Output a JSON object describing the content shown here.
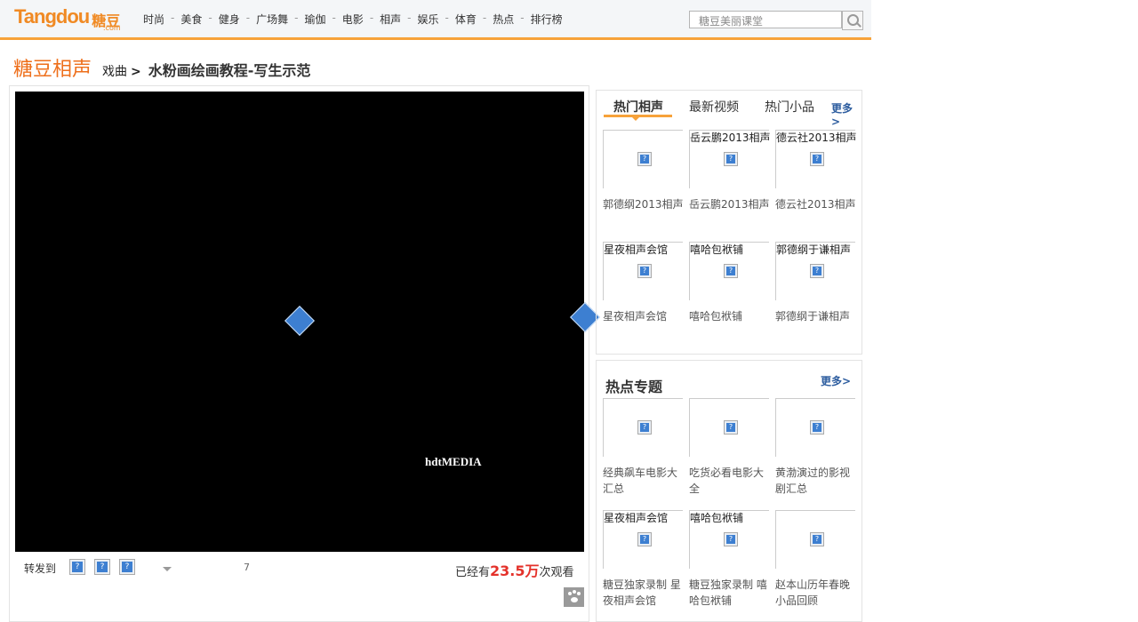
{
  "header": {
    "logo_text": "Tangdou",
    "logo_cn": "糖豆",
    "logo_suffix": ".com",
    "nav": [
      "时尚",
      "美食",
      "健身",
      "广场舞",
      "瑜伽",
      "电影",
      "相声",
      "娱乐",
      "体育",
      "热点",
      "排行榜"
    ],
    "nav_separator": "-",
    "search_placeholder": "糖豆美丽课堂"
  },
  "breadcrumb": {
    "site": "糖豆相声",
    "category": "戏曲",
    "arrow": ">",
    "title": "水粉画绘画教程-写生示范"
  },
  "player": {
    "watermark": "hdtMEDIA",
    "share_label": "转发到",
    "counter": "7",
    "views_prefix": "已经有",
    "views_count": "23.5万",
    "views_suffix": "次观看"
  },
  "hot_panel": {
    "tabs": [
      "热门相声",
      "最新视频",
      "热门小品"
    ],
    "more": "更多>",
    "items": [
      {
        "alt": "",
        "caption": "郭德纲2013相声"
      },
      {
        "alt": "岳云鹏2013相声",
        "caption": "岳云鹏2013相声"
      },
      {
        "alt": "德云社2013相声",
        "caption": "德云社2013相声"
      },
      {
        "alt": "星夜相声会馆",
        "caption": "星夜相声会馆"
      },
      {
        "alt": "嘻哈包袱铺",
        "caption": "嘻哈包袱铺"
      },
      {
        "alt": "郭德纲于谦相声",
        "caption": "郭德纲于谦相声"
      }
    ]
  },
  "topics_panel": {
    "title": "热点专题",
    "more": "更多>",
    "items": [
      {
        "alt": "",
        "caption": "经典飙车电影大汇总"
      },
      {
        "alt": "",
        "caption": "吃货必看电影大全"
      },
      {
        "alt": "",
        "caption": "黄渤演过的影视剧汇总"
      },
      {
        "alt": "星夜相声会馆",
        "caption": "糖豆独家录制 星夜相声会馆"
      },
      {
        "alt": "嘻哈包袱铺",
        "caption": "糖豆独家录制 嘻哈包袱铺"
      },
      {
        "alt": "",
        "caption": "赵本山历年春晚小品回顾"
      }
    ]
  },
  "colors": {
    "accent_orange": "#f08a24",
    "header_border": "#f7a23a",
    "views_red": "#e4322b",
    "link_blue": "#2d5d9f"
  },
  "icons": [
    "search-icon",
    "plugin-missing-icon",
    "broken-image-icon",
    "paw-icon",
    "dropdown-caret-icon"
  ]
}
